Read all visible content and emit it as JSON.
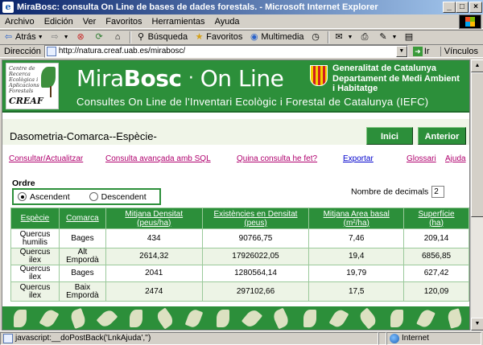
{
  "window": {
    "title": "MiraBosc: consulta On Line de bases de dades forestals. - Microsoft Internet Explorer",
    "minimize": "_",
    "maximize": "□",
    "close": "×"
  },
  "menu": [
    {
      "label": "Archivo"
    },
    {
      "label": "Edición"
    },
    {
      "label": "Ver"
    },
    {
      "label": "Favoritos"
    },
    {
      "label": "Herramientas"
    },
    {
      "label": "Ayuda"
    }
  ],
  "toolbar": {
    "back": "Atrás",
    "search": "Búsqueda",
    "favorites": "Favoritos",
    "multimedia": "Multimedia"
  },
  "address": {
    "label": "Dirección",
    "url": "http://natura.creaf.uab.es/mirabosc/",
    "go": "Ir",
    "links": "Vínculos"
  },
  "banner": {
    "creaf_text": "Centre de Recerca Ecològica i Aplicacions Forestals",
    "creaf_name": "CREAF",
    "brand_a": "Mira",
    "brand_b": "Bosc",
    "brand_dot": "·",
    "brand_c": "On Line",
    "subtitle": "Consultes On Line de l'Inventari Ecològic i Forestal de Catalunya (IEFC)",
    "gen_line1": "Generalitat de Catalunya",
    "gen_line2": "Departament de Medi Ambient",
    "gen_line3": "i Habitatge"
  },
  "page": {
    "title": "Dasometria-Comarca--Espècie-",
    "btn_home": "Inici",
    "btn_prev": "Anterior",
    "links": {
      "consult": "Consultar/Actualitzar",
      "advanced": "Consulta avançada amb SQL",
      "which": "Quina consulta he fet?",
      "export": "Exportar",
      "glossary": "Glossari",
      "help": "Ajuda"
    },
    "order_label": "Ordre",
    "asc": "Ascendent",
    "desc": "Descendent",
    "order_selected": "Ascendent",
    "decimals_label": "Nombre de decimals",
    "decimals_value": "2"
  },
  "table": {
    "headers": [
      {
        "l1": "Espècie",
        "l2": ""
      },
      {
        "l1": "Comarca",
        "l2": ""
      },
      {
        "l1": "Mitjana Densitat",
        "l2": "(peus/ha)"
      },
      {
        "l1": "Existències en Densitat",
        "l2": "(peus)"
      },
      {
        "l1": "Mitjana Area basal",
        "l2": "(m²/ha)"
      },
      {
        "l1": "Superfície",
        "l2": "(ha)"
      }
    ],
    "rows": [
      {
        "species": "Quercus humilis",
        "comarca": "Bages",
        "density": "434",
        "stock": "90766,75",
        "basal": "7,46",
        "area": "209,14"
      },
      {
        "species": "Quercus ilex",
        "comarca": "Alt Empordà",
        "density": "2614,32",
        "stock": "17926022,05",
        "basal": "19,4",
        "area": "6856,85"
      },
      {
        "species": "Quercus ilex",
        "comarca": "Bages",
        "density": "2041",
        "stock": "1280564,14",
        "basal": "19,79",
        "area": "627,42"
      },
      {
        "species": "Quercus ilex",
        "comarca": "Baix Empordà",
        "density": "2474",
        "stock": "297102,66",
        "basal": "17,5",
        "area": "120,09"
      }
    ]
  },
  "status": {
    "text": "javascript:__doPostBack('LnkAjuda','')",
    "zone": "Internet"
  },
  "colors": {
    "brand_green": "#2c8f3a",
    "link_magenta": "#b0006e",
    "link_blue": "#0000cc"
  }
}
